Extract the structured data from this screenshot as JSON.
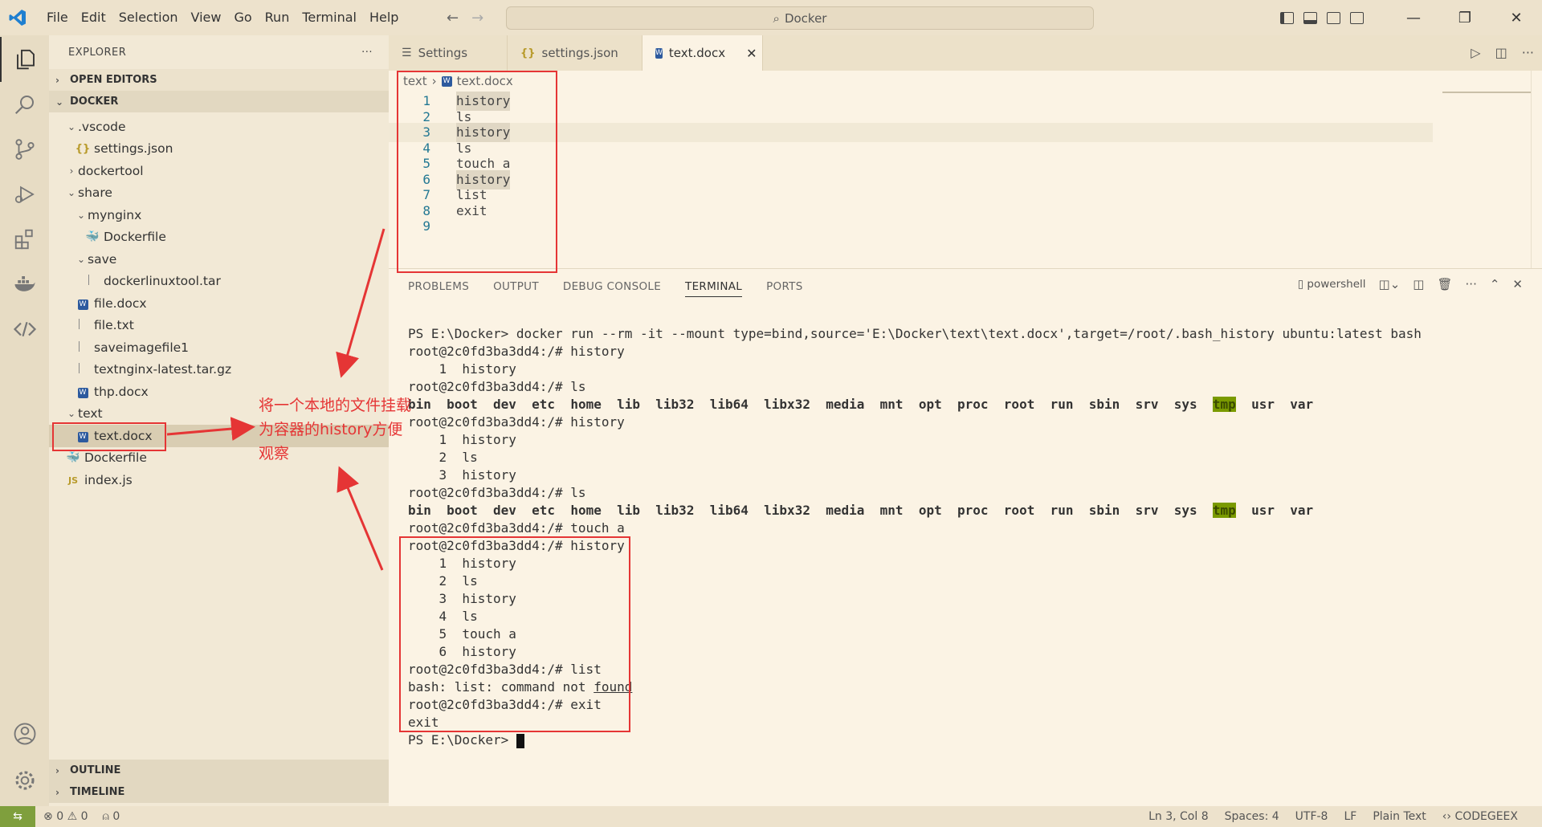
{
  "menu": [
    "File",
    "Edit",
    "Selection",
    "View",
    "Go",
    "Run",
    "Terminal",
    "Help"
  ],
  "command_center": "Docker",
  "explorer": {
    "title": "EXPLORER",
    "more": "···",
    "open_editors": "OPEN EDITORS",
    "workspace": "DOCKER",
    "tree": [
      {
        "label": ".vscode",
        "depth": 1,
        "kind": "folder-open"
      },
      {
        "label": "settings.json",
        "depth": 2,
        "kind": "json"
      },
      {
        "label": "dockertool",
        "depth": 1,
        "kind": "folder-closed"
      },
      {
        "label": "share",
        "depth": 1,
        "kind": "folder-open"
      },
      {
        "label": "mynginx",
        "depth": 2,
        "kind": "folder-open"
      },
      {
        "label": "Dockerfile",
        "depth": 3,
        "kind": "docker"
      },
      {
        "label": "save",
        "depth": 2,
        "kind": "folder-open"
      },
      {
        "label": "dockerlinuxtool.tar",
        "depth": 3,
        "kind": "file"
      },
      {
        "label": "file.docx",
        "depth": 2,
        "kind": "word"
      },
      {
        "label": "file.txt",
        "depth": 2,
        "kind": "file"
      },
      {
        "label": "saveimagefile1",
        "depth": 2,
        "kind": "file"
      },
      {
        "label": "textnginx-latest.tar.gz",
        "depth": 2,
        "kind": "file"
      },
      {
        "label": "thp.docx",
        "depth": 2,
        "kind": "word"
      },
      {
        "label": "text",
        "depth": 1,
        "kind": "folder-open"
      },
      {
        "label": "text.docx",
        "depth": 2,
        "kind": "word",
        "selected": true
      },
      {
        "label": "Dockerfile",
        "depth": 1,
        "kind": "docker"
      },
      {
        "label": "index.js",
        "depth": 1,
        "kind": "js"
      }
    ],
    "outline": "OUTLINE",
    "timeline": "TIMELINE"
  },
  "tabs": [
    {
      "label": "Settings",
      "icon": "settings-icon"
    },
    {
      "label": "settings.json",
      "icon": "json-icon"
    },
    {
      "label": "text.docx",
      "icon": "word-icon",
      "active": true,
      "close": "✕"
    }
  ],
  "editor": {
    "breadcrumb": [
      "text",
      "text.docx"
    ],
    "lines": [
      "history",
      "ls",
      "history",
      "ls",
      "touch a",
      "history",
      "list",
      "exit",
      ""
    ]
  },
  "panel": {
    "tabs": [
      "PROBLEMS",
      "OUTPUT",
      "DEBUG CONSOLE",
      "TERMINAL",
      "PORTS"
    ],
    "active_tab": "TERMINAL",
    "shell": "powershell",
    "terminal": {
      "cmd": "PS E:\\Docker> docker run --rm -it --mount type=bind,source='E:\\Docker\\text\\text.docx',target=/root/.bash_history ubuntu:latest bash",
      "prompt": "root@2c0fd3ba3dd4:/# ",
      "ls_items": [
        "bin",
        "boot",
        "dev",
        "etc",
        "home",
        "lib",
        "lib32",
        "lib64",
        "libx32",
        "media",
        "mnt",
        "opt",
        "proc",
        "root",
        "run",
        "sbin",
        "srv",
        "sys",
        "tmp",
        "usr",
        "var"
      ],
      "list_error_prefix": "bash: list: command not ",
      "list_error_word": "found",
      "exit_text": "exit",
      "final_prompt": "PS E:\\Docker> "
    }
  },
  "status": {
    "errors": "0",
    "warnings": "0",
    "ports": "0",
    "position": "Ln 3, Col 8",
    "spaces": "Spaces: 4",
    "encoding": "UTF-8",
    "eol": "LF",
    "language": "Plain Text",
    "extra": "CODEGEEX"
  },
  "annotation": {
    "text": "将一个本地的文件挂载为容器的history方便观察",
    "color": "#e53535"
  },
  "colors": {
    "background": "#fbf3e4",
    "sidebar": "#f2e9d6",
    "titlebar": "#ede2cc",
    "accent_remote": "#7f9f3d",
    "tmp_highlight": "#7a9a00"
  }
}
